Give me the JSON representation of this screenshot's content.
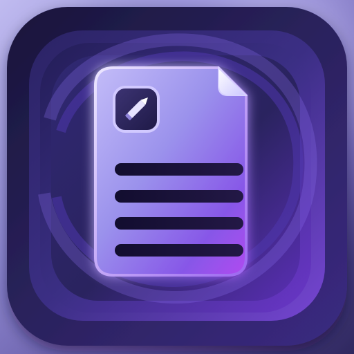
{
  "app_icon": {
    "icon": "document-edit-icon",
    "colors": {
      "background_light": "#b8b2ea",
      "background_dark": "#2f285f",
      "tile_dark": "#1c1842",
      "tile_mid": "#31296b",
      "purple_glow": "#9b62ff",
      "document_top": "#b9b2f3",
      "document_bottom": "#8d48ea",
      "line_color": "#1d163d"
    }
  }
}
